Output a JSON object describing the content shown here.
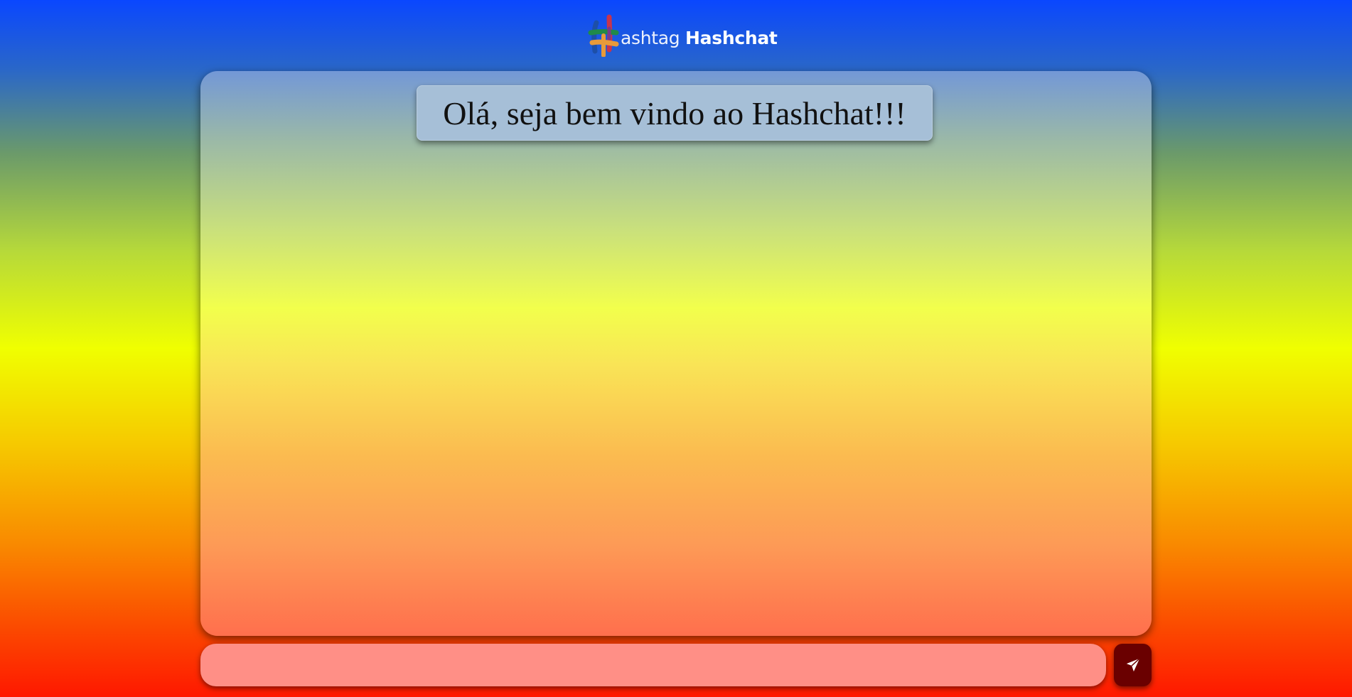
{
  "header": {
    "logo_text_light": "ashtag",
    "logo_text_bold": "Hashchat"
  },
  "chat": {
    "welcome_message": "Olá, seja bem vindo ao Hashchat!!!"
  },
  "composer": {
    "message_value": "",
    "placeholder": "",
    "send_icon": "paper-plane-icon"
  },
  "colors": {
    "send_button": "#6a0000",
    "input_background": "#ff8f86",
    "welcome_background": "#a6bfd7"
  }
}
